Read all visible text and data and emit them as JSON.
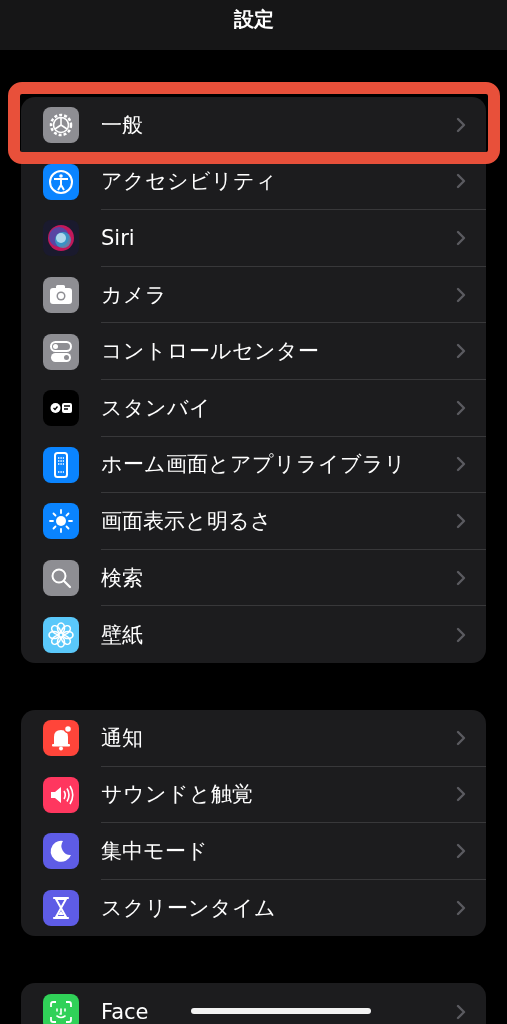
{
  "title": "設定",
  "groups": [
    {
      "items": [
        {
          "label": "一般",
          "kind": "gear",
          "color": "#8e8e93",
          "highlighted": true
        },
        {
          "label": "アクセシビリティ",
          "kind": "accessibility",
          "color": "#0a84ff",
          "highlighted": false
        },
        {
          "label": "Siri",
          "kind": "siri",
          "color": "#1a1a2e",
          "highlighted": false
        },
        {
          "label": "カメラ",
          "kind": "camera",
          "color": "#8e8e93",
          "highlighted": false
        },
        {
          "label": "コントロールセンター",
          "kind": "toggles",
          "color": "#8e8e93",
          "highlighted": false
        },
        {
          "label": "スタンバイ",
          "kind": "standby",
          "color": "#000000",
          "highlighted": false
        },
        {
          "label": "ホーム画面とアプリライブラリ",
          "kind": "phone",
          "color": "#0a84ff",
          "highlighted": false
        },
        {
          "label": "画面表示と明るさ",
          "kind": "sun",
          "color": "#0a84ff",
          "highlighted": false
        },
        {
          "label": "検索",
          "kind": "search",
          "color": "#8e8e93",
          "highlighted": false
        },
        {
          "label": "壁紙",
          "kind": "flower",
          "color": "#5ac8fa",
          "highlighted": false
        }
      ]
    },
    {
      "items": [
        {
          "label": "通知",
          "kind": "bell",
          "color": "#ff453a",
          "highlighted": false
        },
        {
          "label": "サウンドと触覚",
          "kind": "speaker",
          "color": "#ff375f",
          "highlighted": false
        },
        {
          "label": "集中モード",
          "kind": "moon",
          "color": "#5e5ce6",
          "highlighted": false
        },
        {
          "label": "スクリーンタイム",
          "kind": "hourglass",
          "color": "#5e5ce6",
          "highlighted": false
        }
      ]
    },
    {
      "items": [
        {
          "label": "Face",
          "kind": "face",
          "color": "#30d158",
          "highlighted": false
        }
      ]
    }
  ]
}
